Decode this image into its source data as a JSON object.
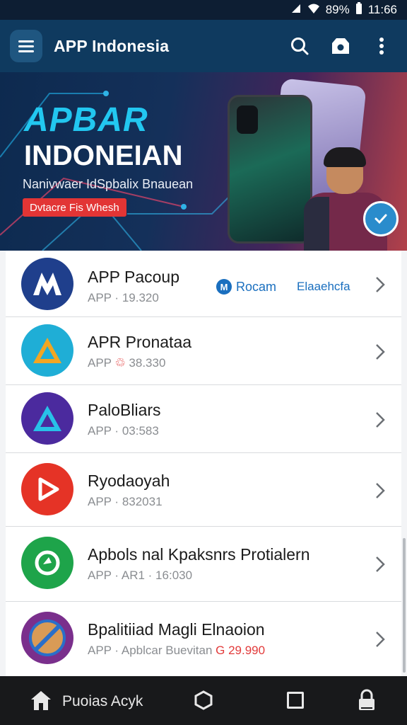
{
  "status": {
    "battery": "89%",
    "time": "11:66",
    "icons": [
      "signal-icon",
      "wifi-icon",
      "battery-icon"
    ]
  },
  "app_bar": {
    "title": "APP Indonesia",
    "actions": [
      "search-icon",
      "store-icon",
      "more-vert-icon"
    ]
  },
  "banner": {
    "headline": "APBAR",
    "title": "INDONEIAN",
    "subtitle": "Nanivwaer IdSpbalix Bnauean",
    "cta": "Dvtacre Fis Whesh"
  },
  "apps": [
    {
      "name": "APP Pacoup",
      "meta": "APP · 19.320",
      "price": "",
      "tag_primary": "Rocam",
      "tag_primary_icon": "M",
      "tag_secondary": "Elaaehcfa",
      "icon_colors": [
        "#1f3f8c",
        "#ffffff"
      ]
    },
    {
      "name": "APR Pronataa",
      "meta": "APP ",
      "price_mark": "♲",
      "meta_tail": " 38.330",
      "icon_colors": [
        "#1faed6",
        "#f2a623"
      ]
    },
    {
      "name": "PaloBliars",
      "meta": "APP · 03:583",
      "icon_colors": [
        "#4b2a9e",
        "#28c1e8"
      ]
    },
    {
      "name": "Ryodaoyah",
      "meta": "APP · 832031",
      "icon_colors": [
        "#e53326",
        "#ffffff"
      ]
    },
    {
      "name": "Apbols nal Kpaksnrs Protialern",
      "meta": "APP · AR1 · 16:030",
      "icon_colors": [
        "#1ea44a",
        "#ffffff"
      ]
    },
    {
      "name": "Bpalitiiad Magli Elnaoion",
      "meta": "APP · Apblcar Buevitan ",
      "price": "G 29.990",
      "icon_colors": [
        "#7a2f8c",
        "#d99b56"
      ]
    }
  ],
  "nav": {
    "label": "Puoias Acyk",
    "icons": [
      "home-icon",
      "back-circle-icon",
      "recents-icon",
      "lock-icon"
    ]
  },
  "colors": {
    "app_bar": "#0f3a5f",
    "status_bar": "#0d1e33",
    "accent": "#1a6fbf",
    "price": "#e23b3b"
  }
}
